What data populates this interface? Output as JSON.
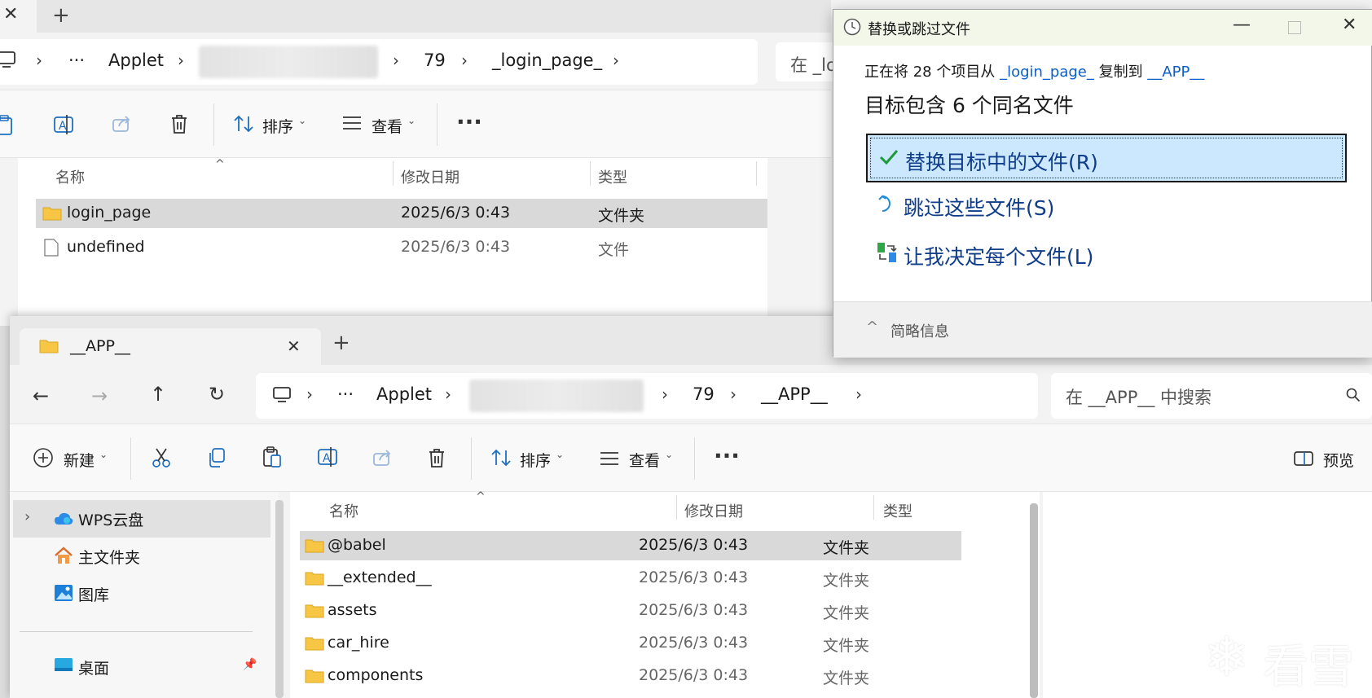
{
  "back_window": {
    "breadcrumbs": [
      "Applet",
      "79",
      "_login_page_"
    ],
    "search_placeholder": "在 _lo",
    "toolbar": {
      "sort_label": "排序",
      "view_label": "查看"
    },
    "columns": [
      "名称",
      "修改日期",
      "类型"
    ],
    "rows": [
      {
        "name": "login_page",
        "date": "2025/6/3 0:43",
        "type": "文件夹",
        "icon": "folder-icon"
      },
      {
        "name": "undefined",
        "date": "2025/6/3 0:43",
        "type": "文件",
        "icon": "file-icon"
      }
    ]
  },
  "front_window": {
    "tab_title": "__APP__",
    "breadcrumbs": [
      "Applet",
      "79",
      "__APP__"
    ],
    "search_placeholder": "在 __APP__ 中搜索",
    "toolbar": {
      "new_label": "新建",
      "sort_label": "排序",
      "view_label": "查看",
      "preview_label": "预览"
    },
    "nav": [
      {
        "label": "WPS云盘",
        "icon": "cloud-icon"
      },
      {
        "label": "主文件夹",
        "icon": "home-icon"
      },
      {
        "label": "图库",
        "icon": "gallery-icon"
      },
      {
        "label": "桌面",
        "icon": "desktop-icon"
      }
    ],
    "columns": [
      "名称",
      "修改日期",
      "类型"
    ],
    "rows": [
      {
        "name": "@babel",
        "date": "2025/6/3 0:43",
        "type": "文件夹"
      },
      {
        "name": "__extended__",
        "date": "2025/6/3 0:43",
        "type": "文件夹"
      },
      {
        "name": "assets",
        "date": "2025/6/3 0:43",
        "type": "文件夹"
      },
      {
        "name": "car_hire",
        "date": "2025/6/3 0:43",
        "type": "文件夹"
      },
      {
        "name": "components",
        "date": "2025/6/3 0:43",
        "type": "文件夹"
      }
    ]
  },
  "dialog": {
    "title": "替换或跳过文件",
    "copy_info": {
      "prefix": "正在将 28 个项目从 ",
      "source": "_login_page_",
      "middle": " 复制到 ",
      "dest": "__APP__"
    },
    "heading": "目标包含 6 个同名文件",
    "options": [
      {
        "label": "替换目标中的文件(R)",
        "icon": "checkmark-icon"
      },
      {
        "label": "跳过这些文件(S)",
        "icon": "skip-icon"
      },
      {
        "label": "让我决定每个文件(L)",
        "icon": "decide-icon"
      }
    ],
    "details_label": "简略信息"
  },
  "watermark": "看雪",
  "colors": {
    "accent": "#0b5fc9",
    "selection": "#cce8ff",
    "folder": "#f6c644"
  }
}
